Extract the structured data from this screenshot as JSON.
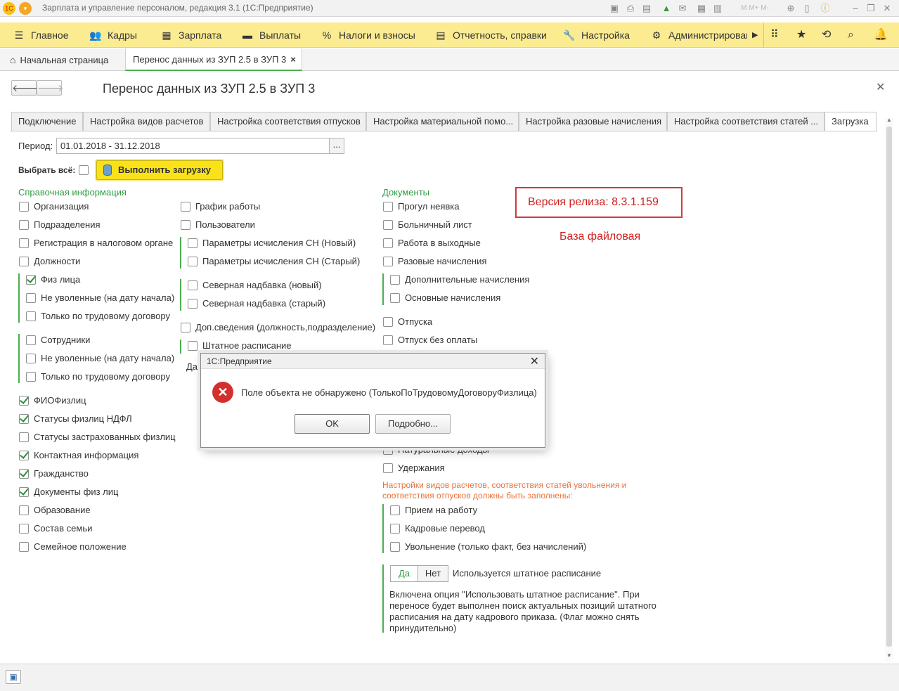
{
  "window": {
    "title": "Зарплата и управление персоналом, редакция 3.1  (1С:Предприятие)"
  },
  "menu": [
    {
      "label": "Главное",
      "icon": "hamburger-icon"
    },
    {
      "label": "Кадры",
      "icon": "people-icon"
    },
    {
      "label": "Зарплата",
      "icon": "calculator-icon"
    },
    {
      "label": "Выплаты",
      "icon": "wallet-icon"
    },
    {
      "label": "Налоги и взносы",
      "icon": "percent-icon"
    },
    {
      "label": "Отчетность, справки",
      "icon": "report-icon"
    },
    {
      "label": "Настройка",
      "icon": "wrench-icon"
    },
    {
      "label": "Администрирован",
      "icon": "gear-icon"
    }
  ],
  "page_tabs": {
    "home": "Начальная страница",
    "current": "Перенос данных из ЗУП 2.5 в ЗУП 3"
  },
  "form": {
    "title": "Перенос данных из ЗУП 2.5 в ЗУП 3",
    "tabs": [
      "Подключение",
      "Настройка видов расчетов",
      "Настройка соответствия отпусков",
      "Настройка материальной помо...",
      "Настройка разовые начисления",
      "Настройка соответствия статей ...",
      "Загрузка"
    ],
    "period_label": "Период:",
    "period_value": "01.01.2018 - 31.12.2018",
    "period_btn": "...",
    "select_all": "Выбрать всё:",
    "run_button": "Выполнить загрузку",
    "ref_header": "Справочная информация",
    "docs_header": "Документы",
    "release_version": "Версия релиза: 8.3.1.159",
    "base_type": "База файловая",
    "warning": "Настройки видов расчетов, соответствия статей увольнения и соответствия отпусков должны быть заполнены:",
    "yes": "Да",
    "no": "Нет",
    "staff_label": "Используется штатное расписание",
    "note": "Включена опция \"Использовать штатное расписание\". При переносе будет выполнен поиск актуальных позиций штатного расписания на дату кадрового приказа. (Флаг можно снять принудительно)",
    "hidden_partial": "Дат"
  },
  "ref_items": [
    {
      "label": "Организация",
      "checked": false
    },
    {
      "label": "Подразделения",
      "checked": false
    },
    {
      "label": "Регистрация в налоговом органе",
      "checked": false
    },
    {
      "label": "Должности",
      "checked": false
    },
    {
      "label": "Физ лица",
      "checked": true
    },
    {
      "label": "Не уволенные (на дату начала)",
      "checked": false
    },
    {
      "label": "Только по трудовому договору",
      "checked": false
    },
    {
      "label": "Сотрудники",
      "checked": false
    },
    {
      "label": "Не уволенные (на дату начала)",
      "checked": false
    },
    {
      "label": "Только по трудовому договору",
      "checked": false
    },
    {
      "label": "ФИОФизлиц",
      "checked": true
    },
    {
      "label": "Статусы физлиц НДФЛ",
      "checked": true
    },
    {
      "label": "Статусы застрахованных физлиц",
      "checked": false
    },
    {
      "label": "Контактная информация",
      "checked": true
    },
    {
      "label": "Гражданство",
      "checked": true
    },
    {
      "label": "Документы физ лиц",
      "checked": true
    },
    {
      "label": "Образование",
      "checked": false
    },
    {
      "label": "Состав семьи",
      "checked": false
    },
    {
      "label": "Семейное положение",
      "checked": false
    }
  ],
  "mid_items": [
    {
      "label": "График работы",
      "checked": false
    },
    {
      "label": "Пользователи",
      "checked": false
    },
    {
      "label": "Параметры исчисления СН (Новый)",
      "checked": false
    },
    {
      "label": "Параметры исчисления СН (Старый)",
      "checked": false
    },
    {
      "label": "Северная надбавка (новый)",
      "checked": false
    },
    {
      "label": "Северная надбавка (старый)",
      "checked": false
    },
    {
      "label": "Доп.сведения (должность,подразделение)",
      "checked": false
    },
    {
      "label": "Штатное расписание",
      "checked": false
    }
  ],
  "doc_items": [
    {
      "label": "Прогул неявка",
      "checked": false
    },
    {
      "label": "Больничный лист",
      "checked": false
    },
    {
      "label": "Работа в выходные",
      "checked": false
    },
    {
      "label": "Разовые начисления",
      "checked": false
    },
    {
      "label": "Дополнительные начисления",
      "checked": false
    },
    {
      "label": "Основные начисления",
      "checked": false
    },
    {
      "label": "Отпуска",
      "checked": false
    },
    {
      "label": "Отпуск без оплаты",
      "checked": false
    },
    {
      "label": "Натуральные доходы",
      "checked": false
    },
    {
      "label": "Удержания",
      "checked": false
    },
    {
      "label": "Прием на работу",
      "checked": false
    },
    {
      "label": "Кадровые перевод",
      "checked": false
    },
    {
      "label": "Увольнение (только факт, без начислений)",
      "checked": false
    }
  ],
  "dialog": {
    "title": "1С:Предприятие",
    "message": "Поле объекта не обнаружено (ТолькоПоТрудовомуДоговоруФизлица)",
    "ok": "OK",
    "details": "Подробно..."
  },
  "colors": {
    "menu_bg": "#fbeb91",
    "green": "#2f9c44",
    "red": "#d02020",
    "run_btn": "#f9e21a"
  }
}
